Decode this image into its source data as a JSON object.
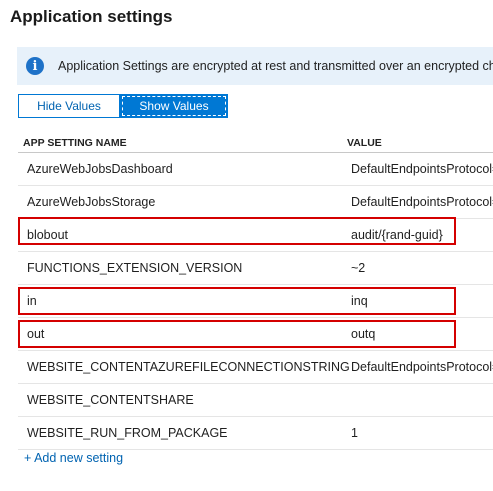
{
  "page": {
    "title": "Application settings"
  },
  "info": {
    "icon": "info-icon",
    "text": "Application Settings are encrypted at rest and transmitted over an encrypted channel."
  },
  "toggle": {
    "hide_label": "Hide Values",
    "show_label": "Show Values",
    "selected": "Show Values"
  },
  "table": {
    "headers": {
      "name": "APP SETTING NAME",
      "value": "VALUE"
    },
    "rows": [
      {
        "name": "AzureWebJobsDashboard",
        "value": "DefaultEndpointsProtocol=",
        "highlighted": false
      },
      {
        "name": "AzureWebJobsStorage",
        "value": "DefaultEndpointsProtocol=",
        "highlighted": false
      },
      {
        "name": "blobout",
        "value": "audit/{rand-guid}",
        "highlighted": true
      },
      {
        "name": "FUNCTIONS_EXTENSION_VERSION",
        "value": "~2",
        "highlighted": false
      },
      {
        "name": "in",
        "value": "inq",
        "highlighted": true
      },
      {
        "name": "out",
        "value": "outq",
        "highlighted": true
      },
      {
        "name": "WEBSITE_CONTENTAZUREFILECONNECTIONSTRING",
        "value": "DefaultEndpointsProtocol=",
        "highlighted": false
      },
      {
        "name": "WEBSITE_CONTENTSHARE",
        "value": "",
        "highlighted": false
      },
      {
        "name": "WEBSITE_RUN_FROM_PACKAGE",
        "value": "1",
        "highlighted": false
      }
    ]
  },
  "actions": {
    "add_label": "+ Add new setting"
  },
  "colors": {
    "accent": "#0078d4",
    "highlight": "#d40000",
    "info_bg": "#e7f1fa"
  }
}
